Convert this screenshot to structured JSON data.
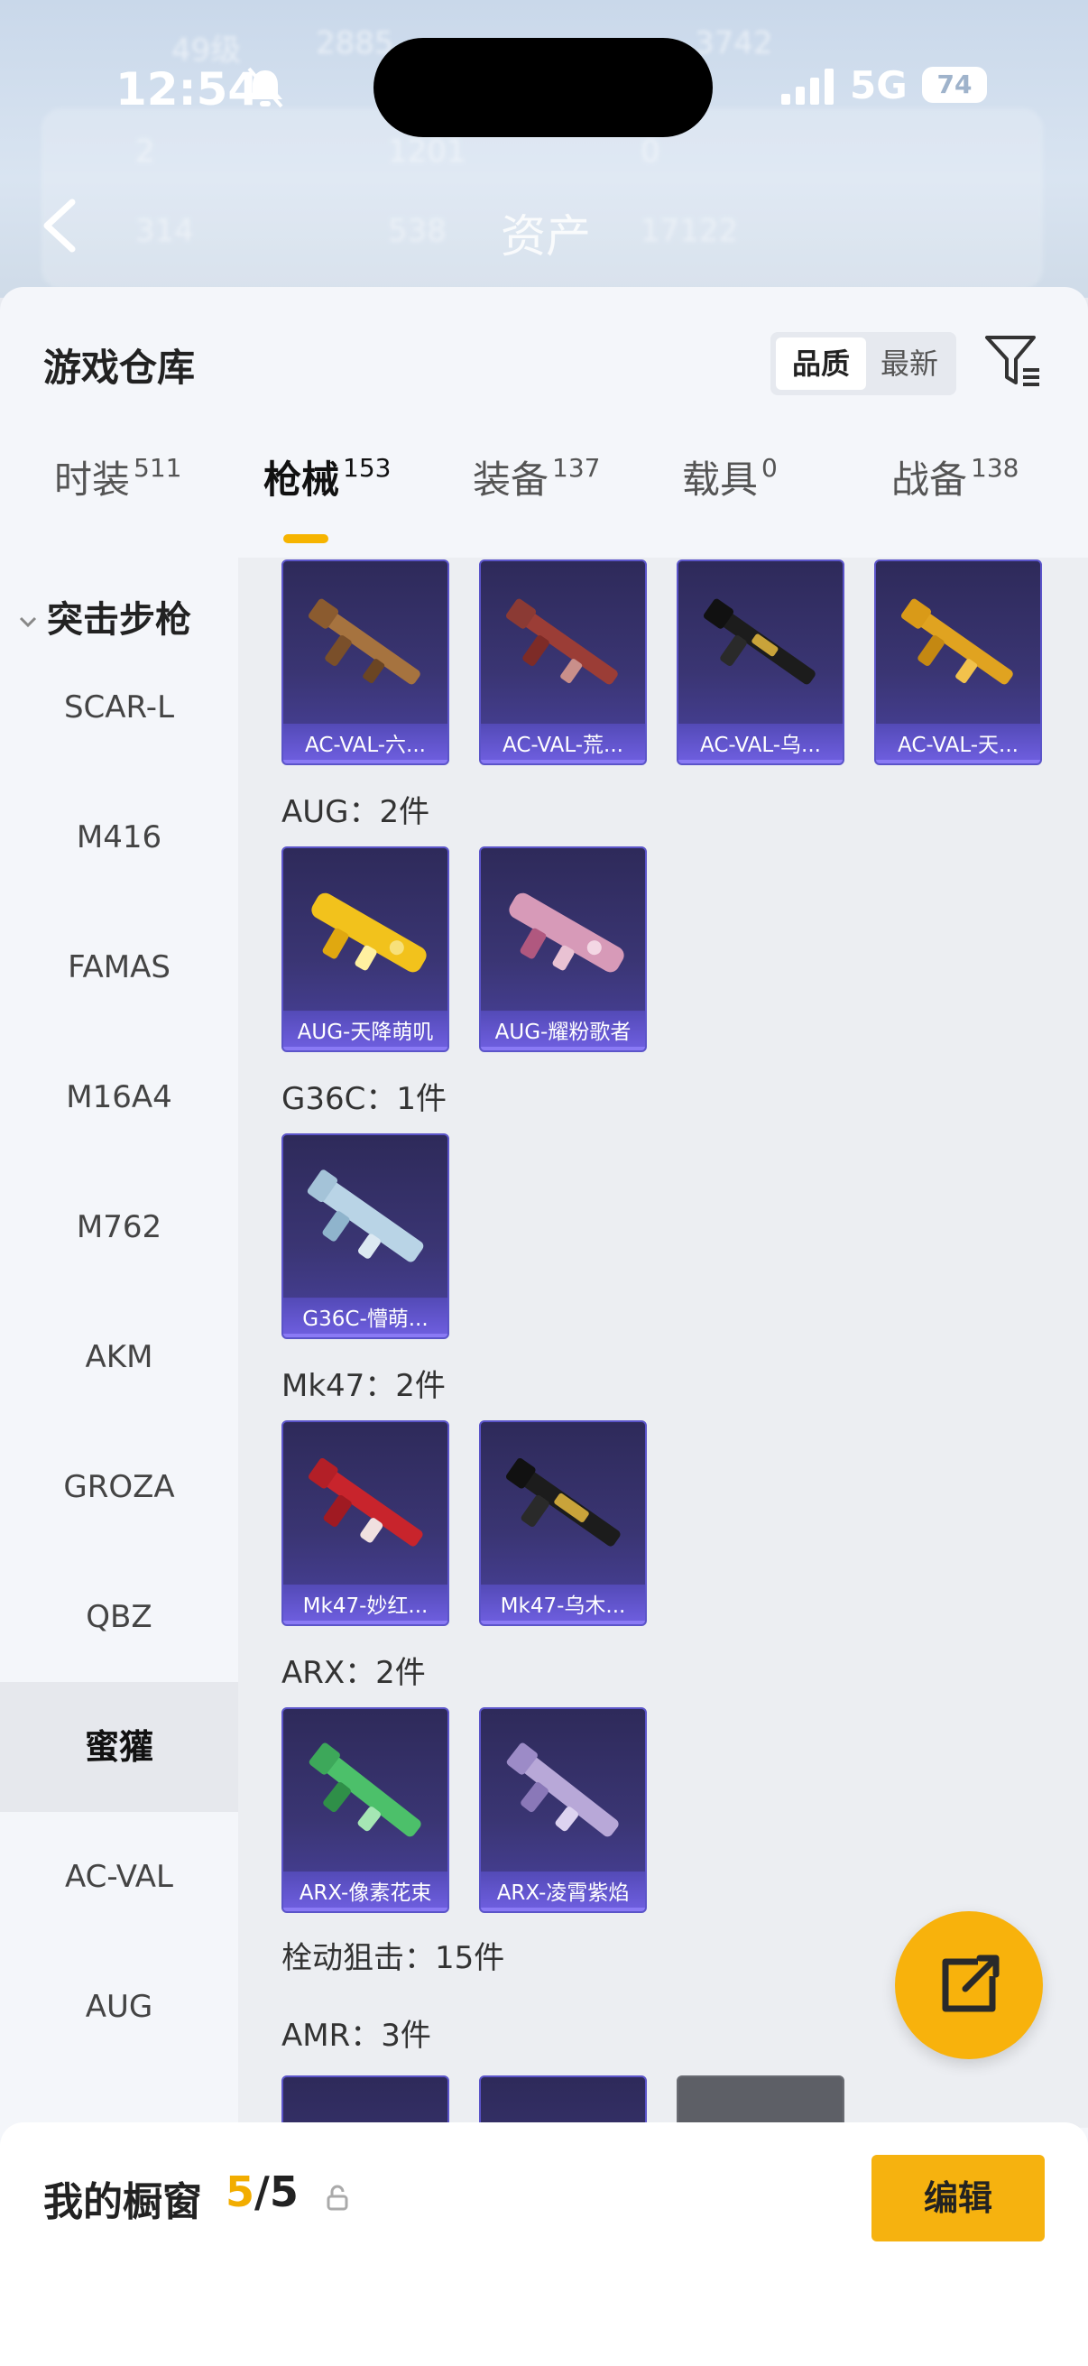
{
  "status_bar": {
    "time": "12:54",
    "network": "5G",
    "battery": "74"
  },
  "background_page": {
    "title": "资产",
    "row1": [
      "49级",
      "2885",
      "3742"
    ],
    "row2": [
      "2",
      "1201",
      "0"
    ],
    "row3": [
      "314",
      "538",
      "17122"
    ]
  },
  "sheet": {
    "title": "游戏仓库",
    "sort": {
      "active": "品质",
      "inactive": "最新"
    }
  },
  "tabs": [
    {
      "label": "时装",
      "count": "511"
    },
    {
      "label": "枪械",
      "count": "153"
    },
    {
      "label": "装备",
      "count": "137"
    },
    {
      "label": "载具",
      "count": "0"
    },
    {
      "label": "战备",
      "count": "138"
    }
  ],
  "sidebar": {
    "category": "突击步枪",
    "items": [
      "SCAR-L",
      "M416",
      "FAMAS",
      "M16A4",
      "M762",
      "AKM",
      "GROZA",
      "QBZ",
      "蜜獾",
      "AC-VAL",
      "AUG"
    ],
    "active": "蜜獾"
  },
  "groups": {
    "acval": {
      "items": [
        "AC-VAL-六...",
        "AC-VAL-荒...",
        "AC-VAL-乌...",
        "AC-VAL-天..."
      ]
    },
    "aug": {
      "label": "AUG：2件",
      "items": [
        "AUG-天降萌叽",
        "AUG-耀粉歌者"
      ]
    },
    "g36c": {
      "label": "G36C：1件",
      "items": [
        "G36C-懵萌..."
      ]
    },
    "mk47": {
      "label": "Mk47：2件",
      "items": [
        "Mk47-妙红...",
        "Mk47-乌木..."
      ]
    },
    "arx": {
      "label": "ARX：2件",
      "items": [
        "ARX-像素花束",
        "ARX-凌霄紫焰"
      ]
    },
    "bolt": {
      "label": "栓动狙击：15件"
    },
    "amr": {
      "label": "AMR：3件"
    }
  },
  "bottom": {
    "label": "我的橱窗",
    "current": "5",
    "total": "/5",
    "edit": "编辑"
  }
}
